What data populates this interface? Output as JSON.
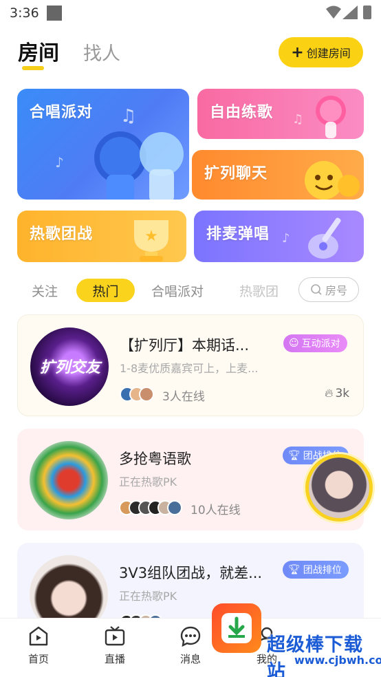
{
  "status_bar": {
    "time": "3:36"
  },
  "header": {
    "tab_rooms": "房间",
    "tab_people": "找人",
    "create_button": "创建房间"
  },
  "categories": {
    "chorus": "合唱派对",
    "free_practice": "自由练歌",
    "expand_chat": "扩列聊天",
    "hot_team": "热歌团战",
    "mic_play": "排麦弹唱"
  },
  "filters": {
    "follow": "关注",
    "hot": "热门",
    "chorus": "合唱派对",
    "hot_team": "热歌团",
    "search_placeholder": "房号"
  },
  "rooms": [
    {
      "title": "【扩列厅】本期话...",
      "subtitle": "1-8麦优质嘉宾可上，上麦...",
      "tag": "互动派对",
      "online": "3人在线",
      "heat": "3k",
      "avatar_text": "扩列交友"
    },
    {
      "title": "多抢粤语歌",
      "subtitle": "正在热歌PK",
      "tag": "团战排位",
      "online": "10人在线"
    },
    {
      "title": "3V3组队团战，就差...",
      "subtitle": "正在热歌PK",
      "tag": "团战排位"
    }
  ],
  "bottom_nav": {
    "home": "首页",
    "live": "直播",
    "messages": "消息",
    "me": "我的"
  },
  "watermark": {
    "text": "超级棒下载站",
    "url": "www.cjbwh.com"
  },
  "colors": {
    "accent": "#fbd114",
    "party_tag": "#d476f2",
    "team_tag": "#6f8af7"
  }
}
